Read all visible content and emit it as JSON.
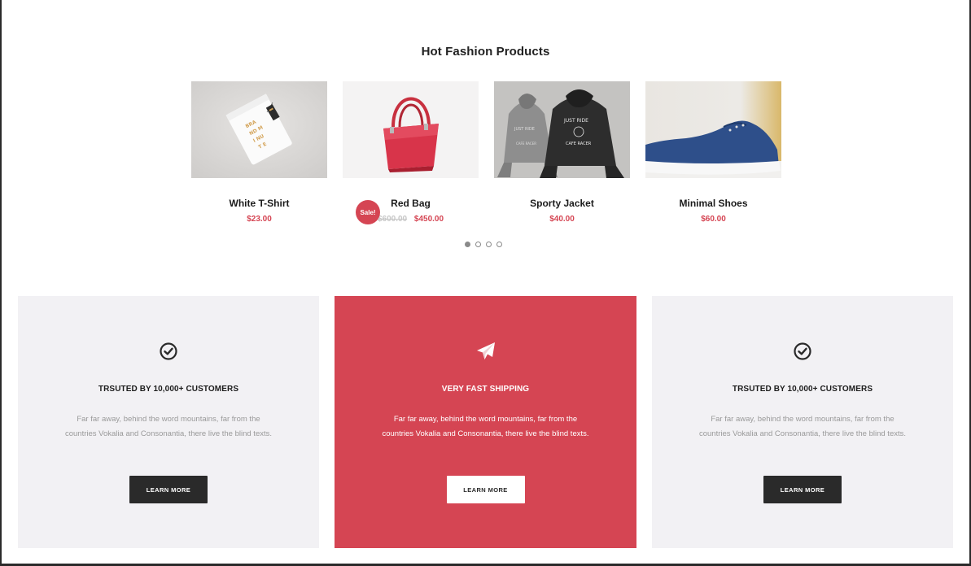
{
  "section": {
    "title": "Hot Fashion Products"
  },
  "products": [
    {
      "name": "White T-Shirt",
      "price": "$23.00",
      "old_price": ""
    },
    {
      "name": "Red Bag",
      "price": "$450.00",
      "old_price": "$600.00",
      "badge": "Sale!"
    },
    {
      "name": "Sporty Jacket",
      "price": "$40.00",
      "old_price": ""
    },
    {
      "name": "Minimal Shoes",
      "price": "$60.00",
      "old_price": ""
    }
  ],
  "carousel": {
    "pages": 4,
    "active": 1
  },
  "features": [
    {
      "icon": "check-circle-icon",
      "title": "TRSUTED BY 10,000+ CUSTOMERS",
      "text": "Far far away, behind the word mountains, far from the countries Vokalia and Consonantia, there live the blind texts.",
      "button": "LEARN MORE"
    },
    {
      "icon": "paper-plane-icon",
      "title": "VERY FAST SHIPPING",
      "text": "Far far away, behind the word mountains, far from the countries Vokalia and Consonantia, there live the blind texts.",
      "button": "LEARN MORE"
    },
    {
      "icon": "check-circle-icon",
      "title": "TRSUTED BY 10,000+ CUSTOMERS",
      "text": "Far far away, behind the word mountains, far from the countries Vokalia and Consonantia, there live the blind texts.",
      "button": "LEARN MORE"
    }
  ],
  "colors": {
    "accent": "#d54553",
    "dark": "#2a2a2a",
    "panel": "#f2f1f4"
  }
}
